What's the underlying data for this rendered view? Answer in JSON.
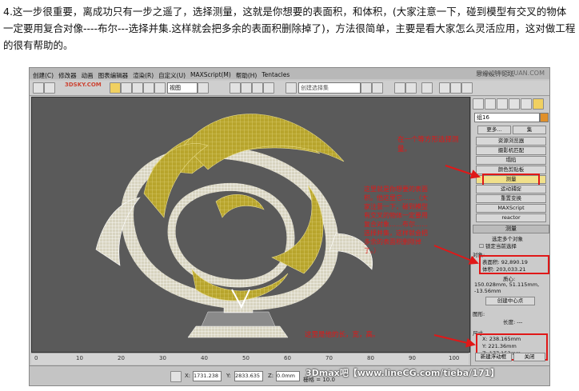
{
  "intro": {
    "text": "4.这一步很重要，离成功只有一步之遥了，选择测量，这就是你想要的表面积，和体积，(大家注意一下，碰到模型有交叉的物体一定要用复合对像----布尔---选择并集.这样就会把多余的表面积删除掉了)，方法很简单，主要是看大家怎么灵活应用，这对做工程的很有帮助的。"
  },
  "window": {
    "title": "思缘设计论坛",
    "watermark_site": "www.MISSYUAN.COM",
    "logo_text": "3DSKY.COM"
  },
  "menu": {
    "items": [
      "创建(C)",
      "修改器",
      "动画",
      "图表编辑器",
      "渲染(R)",
      "自定义(U)",
      "MAXScript(M)",
      "帮助(H)",
      "Tentacles"
    ]
  },
  "toolbar": {
    "view_label": "视图",
    "selection_set_placeholder": "创建选择集"
  },
  "panel": {
    "object_name": "组16",
    "more_button": "更多...",
    "sets_button": "集",
    "utilities": [
      "资源浏览器",
      "摄影机匹配",
      "塌陷",
      "颜色剪贴板",
      "测量",
      "运动捕捉",
      "重置变换",
      "MAXScript",
      "reactor"
    ],
    "selected_utility": "测量",
    "rollout_title": "测量",
    "multi_selected": "选定多个对象",
    "lock_selection": "锁定当前选择",
    "objects_label": "对象:",
    "surface_area": "表面积: 92,890.19",
    "volume": "体积: 203,033.21",
    "center_label": "质心:",
    "center_value": "150.028mm, 51.115mm, -13.56mm",
    "create_center": "创建中心点",
    "shapes_label": "图形:",
    "length_label": "长度: ---",
    "dims_label": "尺寸",
    "dim_x": "X: 238.165mm",
    "dim_y": "Y: 221.36mm",
    "dim_z": "Z: 177.153mm",
    "new_float": "新建浮动框",
    "close": "关闭"
  },
  "annotations": {
    "a1": "在一个等方形选择测量。",
    "a2": "这里就是你想要的表面积。他这里它……（大家注意一下，碰到模型有交叉的物体一定要用复合对象……布尔……选择并集，这样就会把多余的表面积删除掉了。）",
    "a3": "这里是他的长，宽，高。"
  },
  "scale_ticks": [
    "0",
    "10",
    "20",
    "30",
    "40",
    "50",
    "60",
    "70",
    "80",
    "90",
    "100"
  ],
  "status": {
    "x_label": "X:",
    "x_value": "1731.238",
    "y_label": "Y:",
    "y_value": "2833.635",
    "z_label": "Z:",
    "z_value": "0.0mm",
    "grid": "栅格 = 10.0",
    "brand": "3Dmax吧【www.lineCG.com/tieba/171】"
  },
  "colors": {
    "accent_red": "#e01818",
    "model_gold": "#b8a52c",
    "viewport": "#5a5a5a"
  }
}
